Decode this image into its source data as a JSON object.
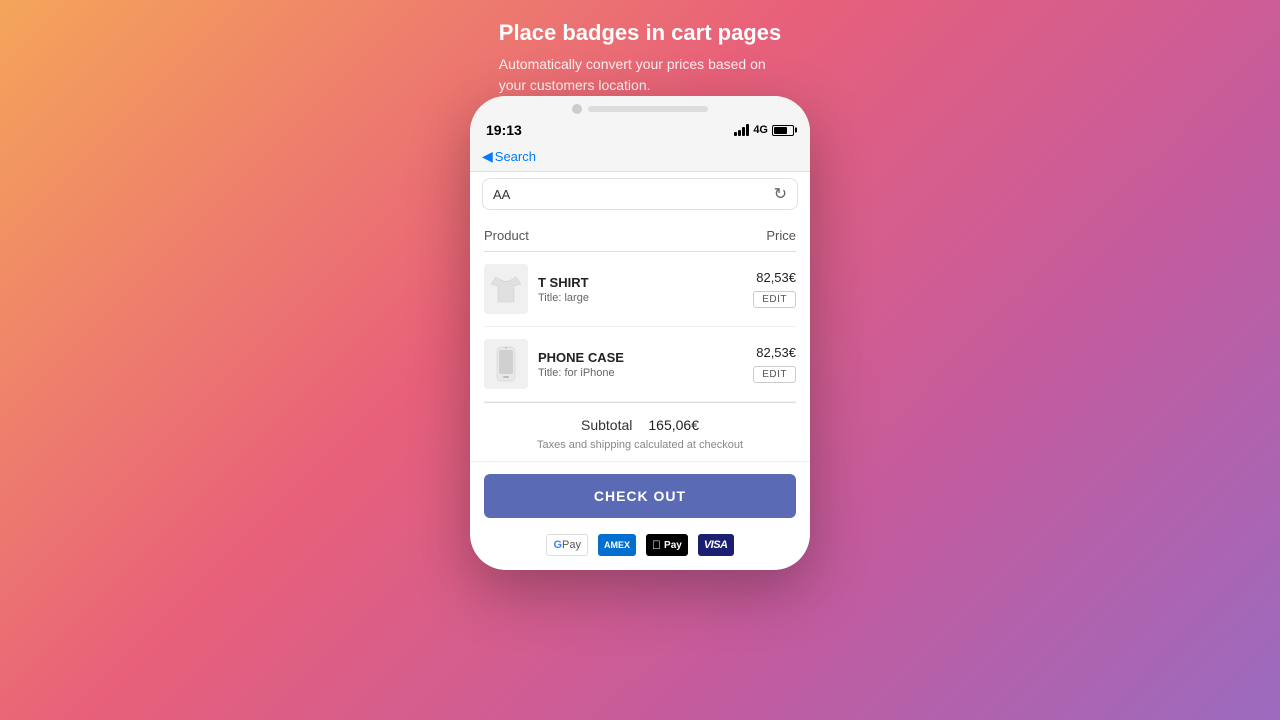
{
  "header": {
    "title": "Place badges in cart pages",
    "subtitle": "Automatically convert your prices based on\nyour customers location."
  },
  "phone": {
    "status_bar": {
      "time": "19:13",
      "network": "4G"
    },
    "nav": {
      "back_label": "Search"
    },
    "address_bar": {
      "text": "AA"
    },
    "cart": {
      "columns": {
        "product": "Product",
        "price": "Price"
      },
      "items": [
        {
          "name": "T SHIRT",
          "title": "Title: large",
          "price": "82,53€",
          "edit_label": "EDIT",
          "type": "tshirt"
        },
        {
          "name": "PHONE CASE",
          "title": "Title: for iPhone",
          "price": "82,53€",
          "edit_label": "EDIT",
          "type": "phonecase"
        }
      ],
      "subtotal_label": "Subtotal",
      "subtotal_value": "165,06€",
      "tax_note": "Taxes and shipping calculated at checkout",
      "checkout_label": "CHECK OUT",
      "payment_methods": [
        "Google Pay",
        "American Express",
        "Apple Pay",
        "Visa"
      ]
    }
  }
}
